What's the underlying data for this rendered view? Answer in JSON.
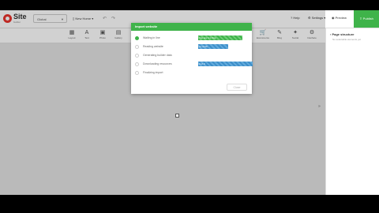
{
  "app": {
    "logo_text": "Site",
    "logo_sub": "builder",
    "language_select": "Global",
    "page_select": "New Home"
  },
  "topbar": {
    "undo_icon": "undo-icon",
    "redo_icon": "redo-icon",
    "help_label": "Help",
    "settings_label": "Settings",
    "preview_label": "Preview",
    "publish_label": "Publish",
    "publish_color": "#3fb34a"
  },
  "toolbar": {
    "items": [
      {
        "label": "Layout",
        "icon": "▦"
      },
      {
        "label": "Text",
        "icon": "A"
      },
      {
        "label": "Photo",
        "icon": "▣"
      },
      {
        "label": "Gallery",
        "icon": "▤"
      },
      {
        "label": "Ecommerce",
        "icon": "🛒"
      },
      {
        "label": "Blog",
        "icon": "✎"
      },
      {
        "label": "Social",
        "icon": "✦"
      },
      {
        "label": "Interface",
        "icon": "⚙"
      }
    ]
  },
  "side_panel": {
    "title": "Page structure",
    "subtitle": "No selectable elements yet"
  },
  "modal": {
    "title": "Import website",
    "accent": "#3fb34a",
    "bar_color": "#3e8fc9",
    "steps": [
      {
        "label": "Waiting in line",
        "done": true,
        "progress_text": "You are 1 in line",
        "progress": 1.0,
        "color": "green"
      },
      {
        "label": "Reading website",
        "done": false,
        "progress_text": "11 of 26",
        "progress": 0.55,
        "color": "blue"
      },
      {
        "label": "Generating builder data",
        "done": false,
        "progress_text": "",
        "progress": 0,
        "color": "none"
      },
      {
        "label": "Downloading resources",
        "done": false,
        "progress_text": "0 of 0",
        "progress": 1.0,
        "color": "blue"
      },
      {
        "label": "Finalizing import",
        "done": false,
        "progress_text": "",
        "progress": 0,
        "color": "none"
      }
    ],
    "close_label": "Close"
  }
}
